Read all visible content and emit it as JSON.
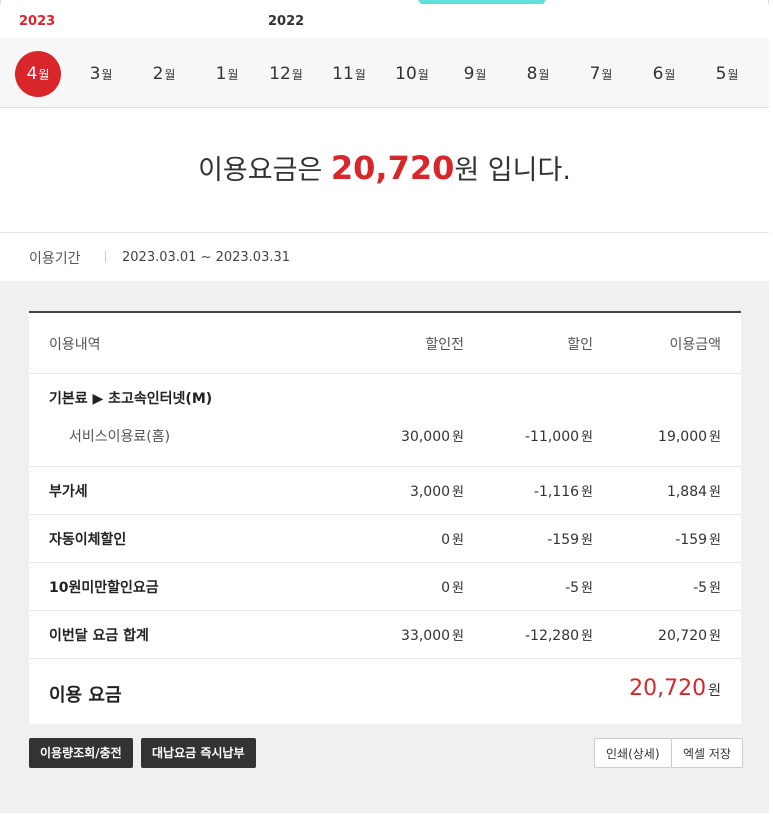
{
  "years": {
    "current": "2023",
    "previous": "2022"
  },
  "months": [
    {
      "num": "4",
      "unit": "월",
      "active": true
    },
    {
      "num": "3",
      "unit": "월"
    },
    {
      "num": "2",
      "unit": "월"
    },
    {
      "num": "1",
      "unit": "월"
    },
    {
      "num": "12",
      "unit": "월"
    },
    {
      "num": "11",
      "unit": "월"
    },
    {
      "num": "10",
      "unit": "월"
    },
    {
      "num": "9",
      "unit": "월"
    },
    {
      "num": "8",
      "unit": "월"
    },
    {
      "num": "7",
      "unit": "월"
    },
    {
      "num": "6",
      "unit": "월"
    },
    {
      "num": "5",
      "unit": "월"
    }
  ],
  "fee": {
    "prefix": "이용요금은 ",
    "amount": "20,720",
    "suffix": "원 입니다."
  },
  "period": {
    "label": "이용기간",
    "value": "2023.03.01 ~ 2023.03.31"
  },
  "table": {
    "headers": [
      "이용내역",
      "할인전",
      "할인",
      "이용금액"
    ],
    "base": {
      "title": "기본료 ▶ 초고속인터넷(M)",
      "item": "서비스이용료(홈)",
      "before": "30,000",
      "discount": "-11,000",
      "amount": "19,000"
    },
    "rows": [
      {
        "name": "부가세",
        "before": "3,000",
        "discount": "-1,116",
        "amount": "1,884"
      },
      {
        "name": "자동이체할인",
        "before": "0",
        "discount": "-159",
        "amount": "-159"
      },
      {
        "name": "10원미만할인요금",
        "before": "0",
        "discount": "-5",
        "amount": "-5"
      },
      {
        "name": "이번달 요금 합계",
        "before": "33,000",
        "discount": "-12,280",
        "amount": "20,720"
      }
    ],
    "total": {
      "label": "이용 요금",
      "amount": "20,720"
    },
    "won": "원"
  },
  "buttons": {
    "usage": "이용량조회/충전",
    "pay": "대납요금 즉시납부",
    "print": "인쇄(상세)",
    "excel": "엑셀 저장"
  },
  "colors": {
    "accent": "#d8262b",
    "tab": "#5fe0dc"
  }
}
